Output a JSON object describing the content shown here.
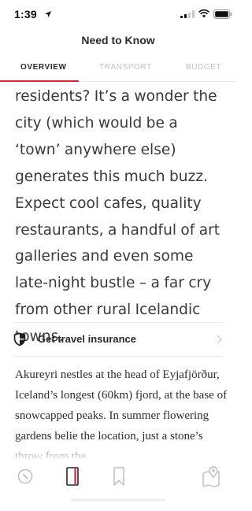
{
  "status_bar": {
    "time": "1:39",
    "location_icon": "location-arrow-icon",
    "signal_icon": "cellular-signal-icon",
    "wifi_icon": "wifi-icon",
    "battery_icon": "battery-icon"
  },
  "header": {
    "title": "Need to Know"
  },
  "tabs": [
    {
      "label": "OVERVIEW",
      "active": true
    },
    {
      "label": "TRANSPORT",
      "active": false
    },
    {
      "label": "BUDGET",
      "active": false
    }
  ],
  "colors": {
    "accent": "#d72638",
    "muted_tab": "#c3c3c3",
    "text": "#2a2a2a"
  },
  "overview": {
    "text": "residents? It’s a wonder the city (which would be a ‘town’ anywhere else) generates this much buzz. Expect cool cafes, quality restaurants, a handful of art galleries and even some late-night bustle – a far cry from other rural Icelandic towns."
  },
  "insurance": {
    "icon": "shield-icon",
    "label": "Get travel insurance",
    "chevron": "chevron-right-icon"
  },
  "body": {
    "text": "Akureyri nestles at the head of Eyjafjörður, Iceland’s longest (60km) fjord, at the base of snowcapped peaks. In summer flowering gardens belie the location, just a stone’s throw from the"
  },
  "bottom_nav": [
    {
      "name": "compass-icon"
    },
    {
      "name": "guidebook-icon",
      "active": true
    },
    {
      "name": "bookmark-icon"
    },
    {
      "name": "map-pin-icon"
    }
  ]
}
